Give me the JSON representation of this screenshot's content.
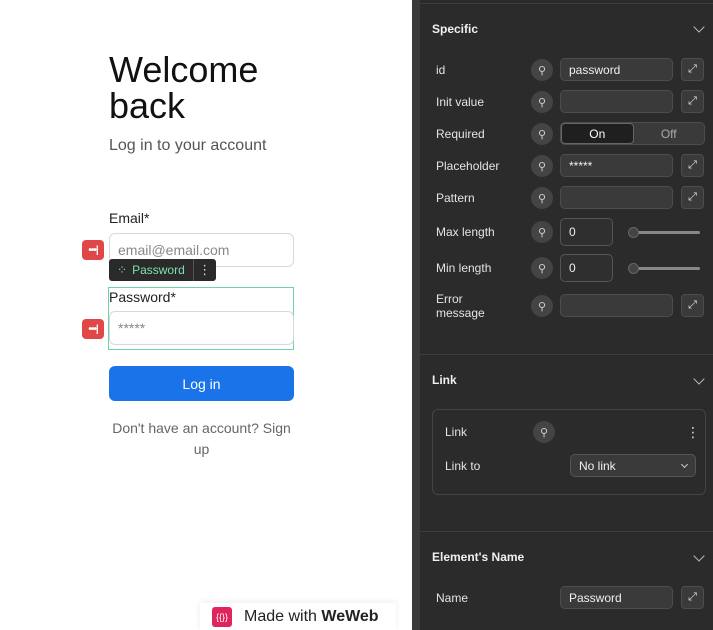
{
  "canvas": {
    "title": "Welcome back",
    "subtitle": "Log in to your account",
    "email_label": "Email*",
    "email_placeholder": "email@email.com",
    "password_tag": "Password",
    "password_label": "Password*",
    "password_placeholder": "*****",
    "login_button": "Log in",
    "signup_text": "Don't have an account? Sign up",
    "made_with_prefix": "Made with",
    "made_with_brand": "WeWeb",
    "logo_text": "{{}}",
    "bind_badge_text": "•••|"
  },
  "panel": {
    "specific": {
      "title": "Specific",
      "id_label": "id",
      "id_value": "password",
      "init_label": "Init value",
      "init_value": "",
      "required_label": "Required",
      "required_on": "On",
      "required_off": "Off",
      "placeholder_label": "Placeholder",
      "placeholder_value": "*****",
      "pattern_label": "Pattern",
      "pattern_value": "",
      "maxlen_label": "Max length",
      "maxlen_value": "0",
      "minlen_label": "Min length",
      "minlen_value": "0",
      "error_label": "Error message",
      "error_value": ""
    },
    "link": {
      "title": "Link",
      "link_label": "Link",
      "link_to_label": "Link to",
      "link_to_value": "No link"
    },
    "element_name": {
      "title": "Element's Name",
      "name_label": "Name",
      "name_value": "Password"
    }
  },
  "colors": {
    "primary": "#1a73e8",
    "panel_bg": "#2b2b2b",
    "selection": "#6fd3a8",
    "bind_badge": "#e04848"
  },
  "icons": {
    "bind": "unlink-icon",
    "expand": "expand-icon",
    "more": "more-vertical-icon",
    "chevron": "chevron-down-icon"
  }
}
